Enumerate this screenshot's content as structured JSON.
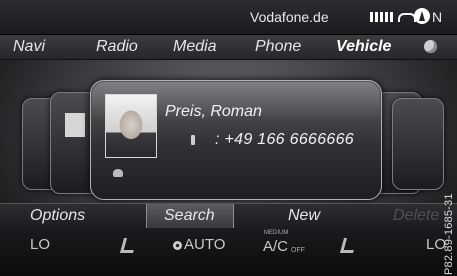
{
  "status": {
    "provider": "Vodafone.de",
    "north": "N"
  },
  "menu": {
    "items": [
      "Navi",
      "Radio",
      "Media",
      "Phone",
      "Vehicle"
    ],
    "selected": "Vehicle"
  },
  "contact": {
    "name": "Preis, Roman",
    "phone": ": +49 166 6666666"
  },
  "submenu": {
    "options": "Options",
    "search": "Search",
    "new": "New",
    "delete": "Delete"
  },
  "climate": {
    "left_temp": "LO",
    "fan_mode": "AUTO",
    "ac_top": "MEDIUM",
    "ac_label": "A/C",
    "ac_state": "OFF",
    "right_temp": "LO"
  },
  "watermark": "P82.89-1685-31",
  "icons": [
    "signal-strength-icon",
    "handset-icon",
    "compass-arrow-icon",
    "globe-icon",
    "phone-icon",
    "contact-icon",
    "seat-heating-left-icon",
    "fan-icon",
    "seat-heating-right-icon"
  ]
}
